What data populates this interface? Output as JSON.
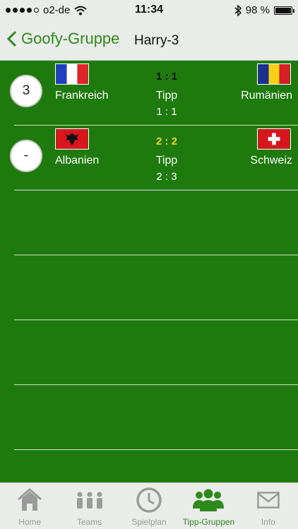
{
  "status_bar": {
    "carrier": "o2-de",
    "time": "11:34",
    "battery": "98 %",
    "battery_level": 0.98
  },
  "nav": {
    "back_label": "Goofy-Gruppe",
    "title": "Harry-3"
  },
  "matches": [
    {
      "points": "3",
      "home_team": "Frankreich",
      "away_team": "Rumänien",
      "result": "1 : 1",
      "result_color": "#111111",
      "tipp_label": "Tipp",
      "tipp": "1 : 1"
    },
    {
      "points": "-",
      "home_team": "Albanien",
      "away_team": "Schweiz",
      "result": "2 : 2",
      "result_color": "#f2d21b",
      "tipp_label": "Tipp",
      "tipp": "2 : 3"
    }
  ],
  "tabs": [
    {
      "label": "Home",
      "icon": "home-icon",
      "active": false
    },
    {
      "label": "Teams",
      "icon": "teams-icon",
      "active": false
    },
    {
      "label": "Spielplan",
      "icon": "clock-icon",
      "active": false
    },
    {
      "label": "Tipp-Gruppen",
      "icon": "group-icon",
      "active": true
    },
    {
      "label": "Info",
      "icon": "mail-icon",
      "active": false
    }
  ],
  "colors": {
    "accent": "#2e8a1a",
    "background": "#1f7a0d"
  }
}
